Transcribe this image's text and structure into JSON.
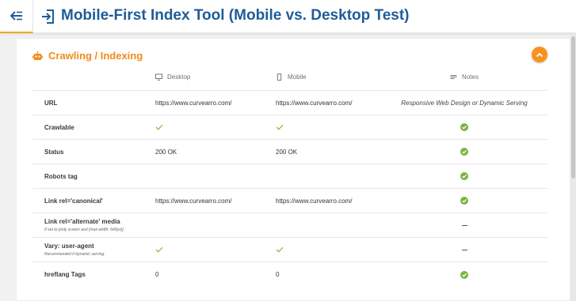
{
  "header": {
    "title": "Mobile-First Index Tool (Mobile vs. Desktop Test)",
    "back_icon": "menu-collapse-arrow-icon",
    "title_icon": "login-arrow-icon"
  },
  "section": {
    "title": "Crawling / Indexing",
    "icon": "robot-icon",
    "collapse_icon": "chevron-up-icon",
    "accent_color": "#f7931e"
  },
  "table": {
    "columns": {
      "desktop": "Desktop",
      "mobile": "Mobile",
      "notes": "Notes"
    },
    "rows": [
      {
        "label": "URL",
        "desktop": "https://www.curvearro.com/",
        "mobile": "https://www.curvearro.com/",
        "notes": "Responsive Web Design or Dynamic Serving"
      },
      {
        "label": "Crawlable",
        "desktop": "check",
        "mobile": "check",
        "notes": "ok"
      },
      {
        "label": "Status",
        "desktop": "200 OK",
        "mobile": "200 OK",
        "notes": "ok"
      },
      {
        "label": "Robots tag",
        "desktop": "",
        "mobile": "",
        "notes": "ok"
      },
      {
        "label": "Link rel='canonical'",
        "desktop": "https://www.curvearro.com/",
        "mobile": "https://www.curvearro.com/",
        "notes": "ok"
      },
      {
        "label": "Link rel='alternate' media",
        "sublabel": "If set to [only screen and (max-width: 640px)].",
        "desktop": "",
        "mobile": "",
        "notes": "dash"
      },
      {
        "label": "Vary: user-agent",
        "sublabel": "Recommended if dynamic serving.",
        "desktop": "check",
        "mobile": "check",
        "notes": "dash"
      },
      {
        "label": "hreflang Tags",
        "desktop": "0",
        "mobile": "0",
        "notes": "ok"
      }
    ]
  },
  "colors": {
    "title_blue": "#1f5c99",
    "check_green": "#8bc34a",
    "ok_green": "#7cb342"
  }
}
